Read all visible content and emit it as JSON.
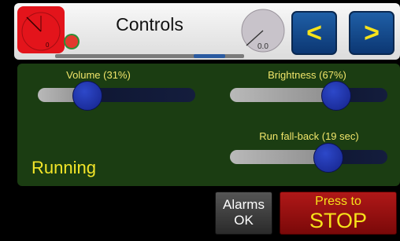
{
  "header": {
    "title": "Controls",
    "gauge_left": {
      "value": "0",
      "color": "#e3141b"
    },
    "gauge_right": {
      "value": "0.0",
      "color": "#c8c3ca"
    },
    "status_led_color": "#e23a2e",
    "prev_label": "<",
    "next_label": ">",
    "nav_color": "#1f5fa7"
  },
  "controls": {
    "volume": {
      "label": "Volume (31%)",
      "value": 0.31
    },
    "brightness": {
      "label": "Brightness (67%)",
      "value": 0.67
    },
    "fallback": {
      "label": "Run fall-back (19 sec)",
      "value": 0.62
    }
  },
  "status": {
    "text": "Running",
    "color": "#f3e629"
  },
  "buttons": {
    "alarms": {
      "line1": "Alarms",
      "line2": "OK"
    },
    "stop": {
      "line1": "Press to",
      "line2": "STOP",
      "color": "#b01818"
    }
  }
}
